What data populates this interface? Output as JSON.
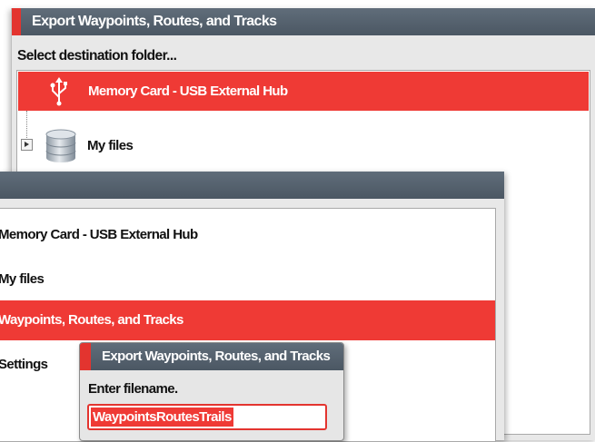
{
  "export_dialog": {
    "title": "Export Waypoints, Routes, and Tracks",
    "subtitle": "Select destination folder...",
    "tree": [
      {
        "label": "Memory Card - USB External Hub",
        "icon": "usb-icon",
        "selected": true
      },
      {
        "label": "My files",
        "icon": "database-icon",
        "selected": false,
        "expandable": true
      }
    ]
  },
  "files_dialog": {
    "items": [
      {
        "label": "Memory Card - USB External Hub"
      },
      {
        "label": "My files"
      },
      {
        "label": "Waypoints, Routes, and Tracks",
        "selected": true
      },
      {
        "label": "Settings"
      }
    ]
  },
  "filename_dialog": {
    "title": "Export Waypoints, Routes, and Tracks",
    "prompt": "Enter filename.",
    "filename_value": "WaypointsRoutesTrails"
  },
  "colors": {
    "accent": "#ef3a35",
    "titlebar": "#56626e",
    "background": "#e8e8e8"
  }
}
